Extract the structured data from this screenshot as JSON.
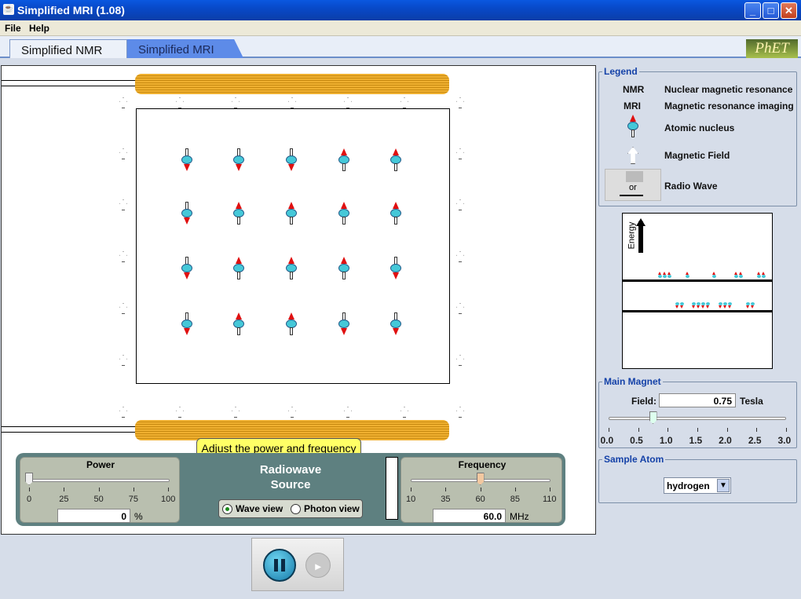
{
  "window": {
    "title": "Simplified MRI (1.08)",
    "app_icon": "java-cup-icon"
  },
  "menu": [
    "File",
    "Help"
  ],
  "tabs": [
    {
      "label": "Simplified NMR",
      "active": true
    },
    {
      "label": "Simplified MRI",
      "active": false
    }
  ],
  "logo": "PhET",
  "tooltip": "Adjust the power and frequency",
  "radiowave_source": {
    "title_line1": "Radiowave",
    "title_line2": "Source"
  },
  "power": {
    "label": "Power",
    "value": "0",
    "unit": "%",
    "ticks": [
      "0",
      "25",
      "50",
      "75",
      "100"
    ],
    "fraction": 0.0
  },
  "frequency": {
    "label": "Frequency",
    "value": "60.0",
    "unit": "MHz",
    "ticks": [
      "10",
      "35",
      "60",
      "85",
      "110"
    ],
    "fraction": 0.5
  },
  "view_mode": {
    "options": [
      "Wave view",
      "Photon view"
    ],
    "selected": "Wave view"
  },
  "legend": {
    "title": "Legend",
    "rows": [
      {
        "key": "NMR",
        "text": "Nuclear magnetic resonance"
      },
      {
        "key": "MRI",
        "text": "Magnetic resonance imaging"
      },
      {
        "icon": "atomic-nucleus-icon",
        "text": "Atomic nucleus"
      },
      {
        "icon": "magnetic-field-arrow-icon",
        "text": "Magnetic Field"
      },
      {
        "icon": "radio-wave-icon",
        "icon_text": "or",
        "text": "Radio Wave"
      }
    ]
  },
  "energy_axis": "Energy",
  "main_magnet": {
    "title": "Main Magnet",
    "field_label": "Field:",
    "value": "0.75",
    "unit": "Tesla",
    "ticks": [
      "0.0",
      "0.5",
      "1.0",
      "1.5",
      "2.0",
      "2.5",
      "3.0"
    ],
    "fraction": 0.25
  },
  "sample_atom": {
    "title": "Sample Atom",
    "selected": "hydrogen"
  },
  "nuclei": [
    [
      "down",
      "down",
      "down",
      "up",
      "up"
    ],
    [
      "down",
      "up",
      "up",
      "up",
      "up"
    ],
    [
      "down",
      "up",
      "up",
      "up",
      "down"
    ],
    [
      "down",
      "up",
      "up",
      "down",
      "down"
    ]
  ],
  "colors": {
    "coil": "#f0b030",
    "nucleus": "#45c8d8",
    "spin_arrow": "#e01010",
    "title_bar": "#0a58e0",
    "panel": "#5e8080"
  }
}
